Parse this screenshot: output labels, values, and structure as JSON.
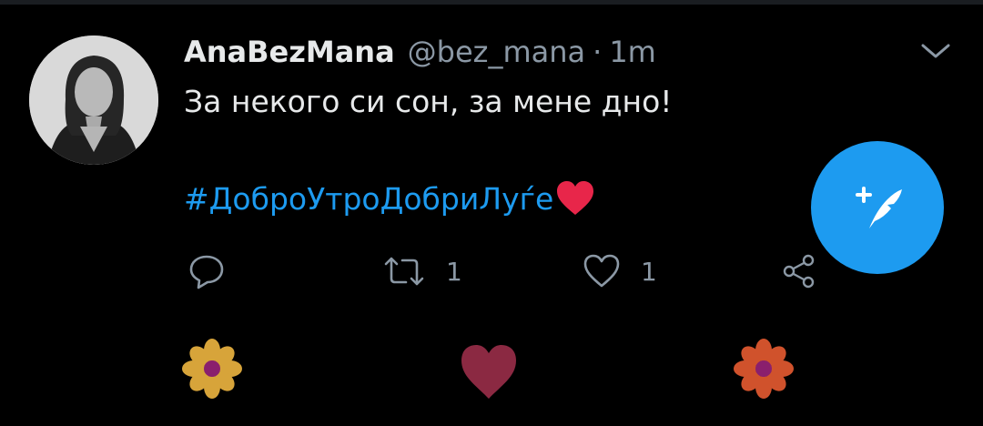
{
  "tweet": {
    "display_name": "AnaBezMana",
    "handle": "@bez_mana",
    "separator": "·",
    "time": "1m",
    "text": "За некого си сон, за мене дно!",
    "hashtag": "#ДоброУтроДобриЛуѓе"
  },
  "actions": {
    "reply_icon": "reply-icon",
    "retweet_count": "1",
    "like_count": "1",
    "share_icon": "share-icon"
  },
  "fab": {
    "icon": "compose-tweet-icon"
  },
  "colors": {
    "background": "#000000",
    "accent": "#1d9bf0",
    "secondary_text": "#8b98a5",
    "primary_text": "#e7e9ea"
  },
  "emojis": [
    "yellow-flower-icon",
    "heart-icon",
    "orange-flower-icon"
  ]
}
